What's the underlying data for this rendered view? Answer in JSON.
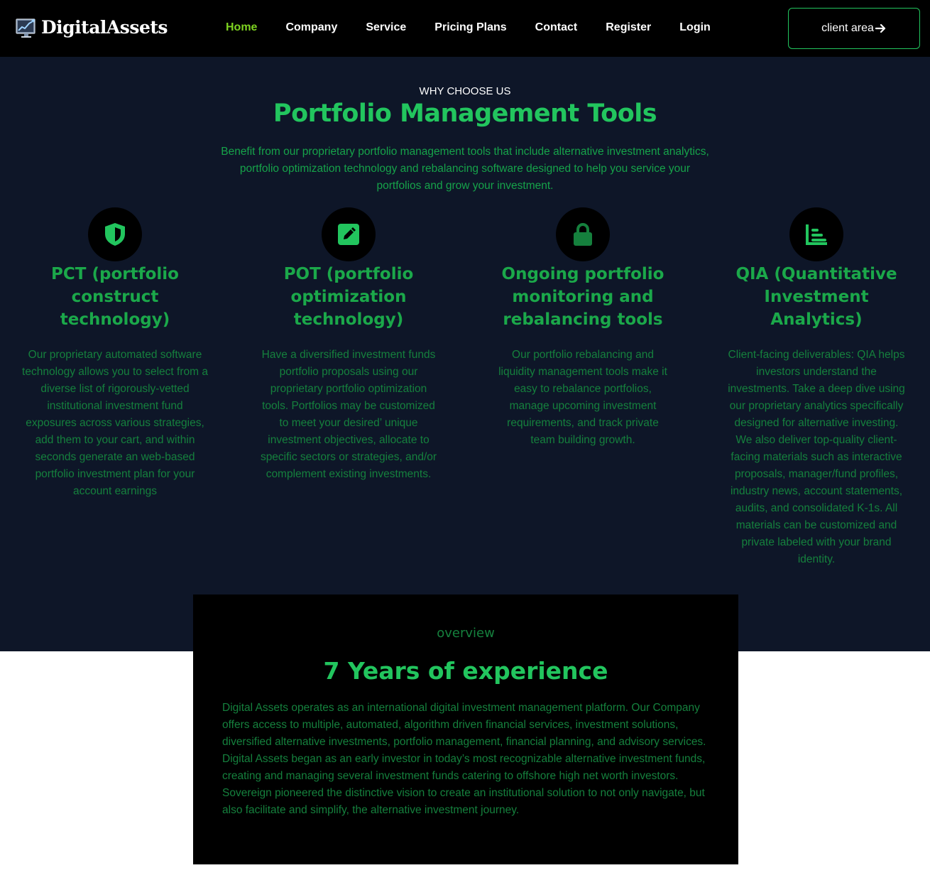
{
  "brand": {
    "name": "DigitalAssets",
    "logo_icon": "chart-monitor-icon"
  },
  "nav": {
    "items": [
      {
        "label": "Home",
        "active": true
      },
      {
        "label": "Company"
      },
      {
        "label": "Service"
      },
      {
        "label": "Pricing Plans"
      },
      {
        "label": "Contact"
      },
      {
        "label": "Register"
      },
      {
        "label": "Login"
      }
    ],
    "client_button": {
      "label": "client area",
      "icon": "arrow-right-icon"
    }
  },
  "features": {
    "eyebrow": "WHY CHOOSE US",
    "title": "Portfolio Management Tools",
    "description": "Benefit from our proprietary portfolio management tools that include alternative investment analytics, portfolio optimization technology and rebalancing software designed to help you service your portfolios and grow your investment.",
    "cards": [
      {
        "icon": "shield-icon",
        "title": "PCT (portfolio construct technology)",
        "description": "Our proprietary automated software technology allows you to select from a diverse list of rigorously-vetted institutional investment fund exposures across various strategies, add them to your cart, and within seconds generate an web-based portfolio investment plan for your account earnings"
      },
      {
        "icon": "edit-square-icon",
        "title": "POT (portfolio optimization technology)",
        "description": "Have a diversified investment funds portfolio proposals using our proprietary portfolio optimization tools. Portfolios may be customized to meet your desired’ unique investment objectives, allocate to specific sectors or strategies, and/or complement existing investments."
      },
      {
        "icon": "lock-icon",
        "title": "Ongoing portfolio monitoring and rebalancing tools",
        "description": "Our portfolio rebalancing and liquidity management tools make it easy to rebalance portfolios, manage upcoming investment requirements, and track private team building growth."
      },
      {
        "icon": "bar-chart-icon",
        "title": "QIA (Quantitative Investment Analytics)",
        "description": "Client-facing deliverables: QIA helps investors understand the investments. Take a deep dive using our proprietary analytics specifically designed for alternative investing. We also deliver top-quality client-facing materials such as interactive proposals, manager/fund profiles, industry news, account statements, audits, and consolidated K-1s. All materials can be customized and private labeled with your brand identity."
      }
    ]
  },
  "overview": {
    "eyebrow": "overview",
    "title": "7 Years of experience",
    "paragraphs": [
      "Digital Assets operates as an international digital investment management platform. Our Company offers access to multiple, automated, algorithm driven financial services, investment solutions, diversified alternative investments, portfolio management, financial planning, and advisory services.",
      "Digital Assets began as an early investor in today’s most recognizable alternative investment funds, creating and managing several investment funds catering to offshore high net worth investors. Sovereign pioneered the distinctive vision to create an institutional solution to not only navigate, but also facilitate and simplify, the alternative investment journey."
    ]
  },
  "colors": {
    "accent_green": "#22c55e",
    "nav_active": "#7ed321",
    "section_bg": "#0e1628",
    "navbar_bg": "#000000"
  }
}
